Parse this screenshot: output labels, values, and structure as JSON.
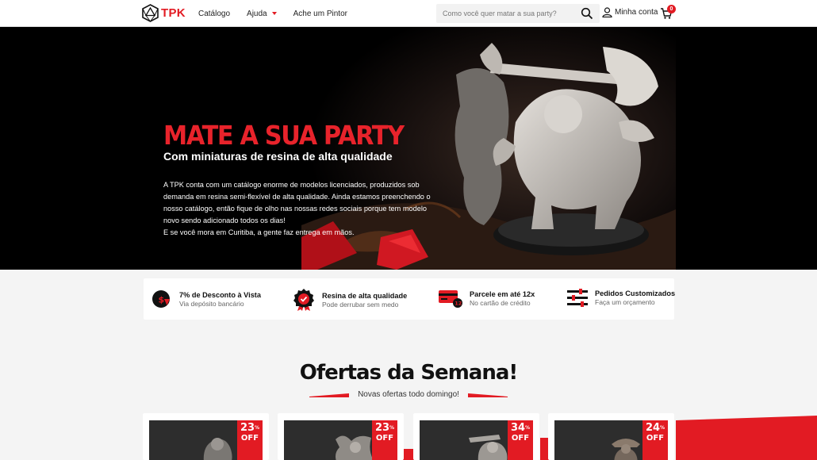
{
  "header": {
    "logo_text": "TPK",
    "nav": [
      {
        "label": "Catálogo"
      },
      {
        "label": "Ajuda",
        "has_dropdown": true
      },
      {
        "label": "Ache um Pintor"
      }
    ],
    "search": {
      "placeholder": "Como você quer matar a sua party?",
      "value": ""
    },
    "account_label": "Minha conta",
    "cart_count": "0"
  },
  "hero": {
    "title": "MATE A SUA PARTY",
    "subtitle": "Com miniaturas de resina de alta qualidade",
    "paragraph1": "A TPK conta com um catálogo enorme de modelos licenciados, produzidos sob demanda em resina semi-flexível de alta qualidade. Ainda estamos preenchendo o nosso catálogo, então fique de olho nas nossas redes sociais porque tem modelo novo sendo adicionado todos os dias!",
    "paragraph2": "E se você mora em Curitiba, a gente faz entrega em mãos."
  },
  "features": [
    {
      "icon": "discount-icon",
      "title": "7% de Desconto à Vista",
      "subtitle": "Via depósito bancário"
    },
    {
      "icon": "quality-badge-icon",
      "title": "Resina de alta qualidade",
      "subtitle": "Pode derrubar sem medo"
    },
    {
      "icon": "credit-card-icon",
      "title": "Parcele em até 12x",
      "subtitle": "No cartão de crédito",
      "card_badge": "12"
    },
    {
      "icon": "sliders-icon",
      "title": "Pedidos Customizados",
      "subtitle": "Faça um orçamento"
    }
  ],
  "offers": {
    "title": "Ofertas da Semana!",
    "subtitle": "Novas ofertas todo domingo!",
    "off_label": "OFF",
    "products": [
      {
        "discount": "23",
        "pct": "%"
      },
      {
        "discount": "23",
        "pct": "%"
      },
      {
        "discount": "34",
        "pct": "%"
      },
      {
        "discount": "24",
        "pct": "%"
      }
    ]
  },
  "colors": {
    "brand_red": "#e21b23",
    "hero_bg": "#000000",
    "page_bg": "#f4f4f4"
  }
}
